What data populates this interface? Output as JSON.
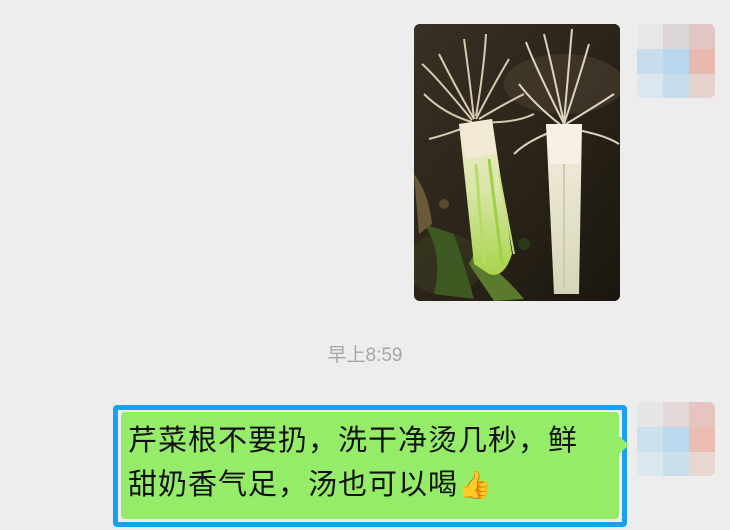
{
  "conversation": {
    "messages": [
      {
        "type": "image",
        "sender": "self",
        "image_description_icon": "celery-roots-photo"
      },
      {
        "type": "timestamp",
        "text": "早上8:59"
      },
      {
        "type": "text",
        "sender": "self",
        "line1": "芹菜根不要扔，洗干净烫几秒，鲜",
        "line2": "甜奶香气足，汤也可以喝",
        "emoji": "👍"
      }
    ]
  },
  "colors": {
    "background": "#ededed",
    "bubble_green": "#95ec69",
    "highlight_outline": "#1aa0f0",
    "timestamp": "#a6a6a6"
  }
}
